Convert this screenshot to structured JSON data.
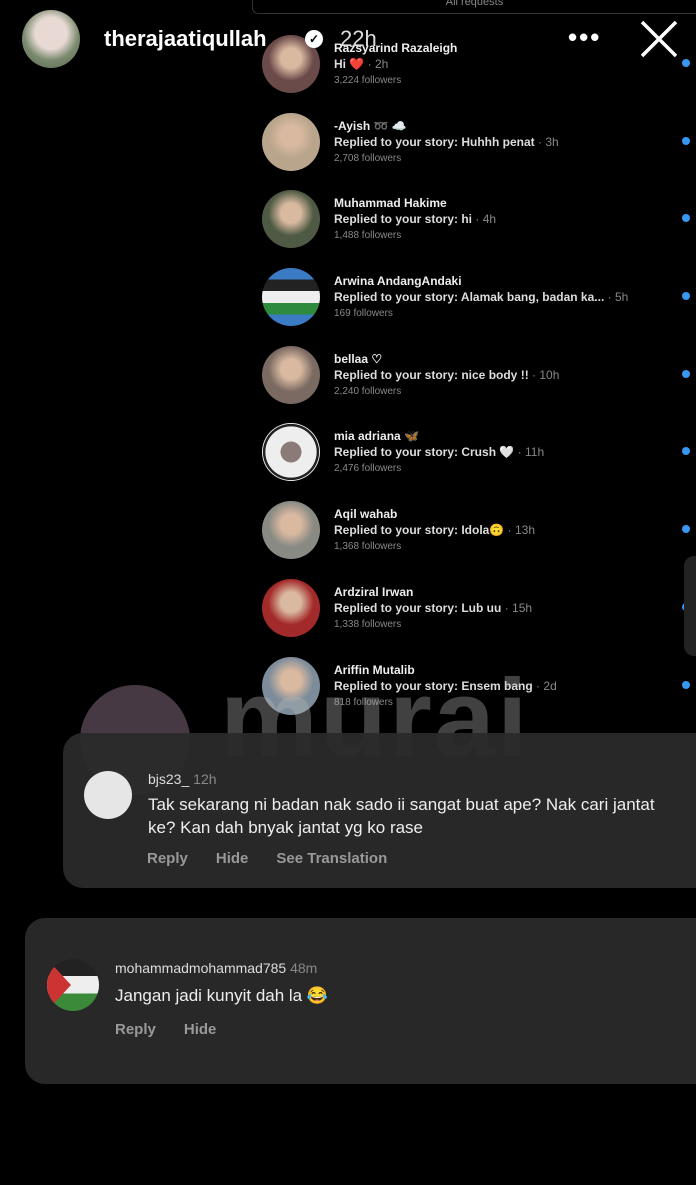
{
  "top_panel": {
    "title": "All requests"
  },
  "header": {
    "username": "therajaatiqullah",
    "time": "22h",
    "more_label": "•••"
  },
  "requests": [
    {
      "name": "Razsyarind Razaleigh",
      "message": "Hi ❤️",
      "time": "2h",
      "followers": "3,224 followers",
      "avatar": "#6b4a4a"
    },
    {
      "name": "-Ayish ➿ ☁️",
      "message": "Replied to your story: Huhhh penat",
      "time": "3h",
      "followers": "2,708 followers",
      "avatar": "#b8a58c"
    },
    {
      "name": "Muhammad Hakime",
      "message": "Replied to your story: hi",
      "time": "4h",
      "followers": "1,488 followers",
      "avatar": "#4f5a44"
    },
    {
      "name": "Arwina AndangAndaki",
      "message": "Replied to your story: Alamak bang, badan ka...",
      "time": "5h",
      "followers": "169 followers",
      "avatar": "flag"
    },
    {
      "name": "bellaa ♡",
      "message": "Replied to your story: nice body !!",
      "time": "10h",
      "followers": "2,240 followers",
      "avatar": "#7a6a62"
    },
    {
      "name": "mia adriana 🦋",
      "message": "Replied to your story: Crush 🤍",
      "time": "11h",
      "followers": "2,476 followers",
      "avatar": "ring"
    },
    {
      "name": "Aqil wahab",
      "message": "Replied to your story: Idola🙃",
      "time": "13h",
      "followers": "1,368 followers",
      "avatar": "#8a8a84"
    },
    {
      "name": "Ardziral Irwan",
      "message": "Replied to your story: Lub uu",
      "time": "15h",
      "followers": "1,338 followers",
      "avatar": "#a32a2a"
    },
    {
      "name": "Ariffin Mutalib",
      "message": "Replied to your story: Ensem bang",
      "time": "2d",
      "followers": "818 followers",
      "avatar": "#7d8c9a"
    }
  ],
  "watermark": "murai",
  "comments": [
    {
      "user": "bjs23_",
      "time": "12h",
      "text": "Tak sekarang ni badan nak sado ii sangat buat ape? Nak cari jantat ke? Kan dah bnyak jantat yg ko rase",
      "actions": [
        "Reply",
        "Hide",
        "See Translation"
      ]
    },
    {
      "user": "mohammadmohammad785",
      "time": "48m",
      "text": "Jangan jadi kunyit dah la 😂",
      "actions": [
        "Reply",
        "Hide"
      ]
    }
  ],
  "colors": {
    "unread_dot": "#3897f0",
    "card_bg": "#2a2a2a"
  }
}
